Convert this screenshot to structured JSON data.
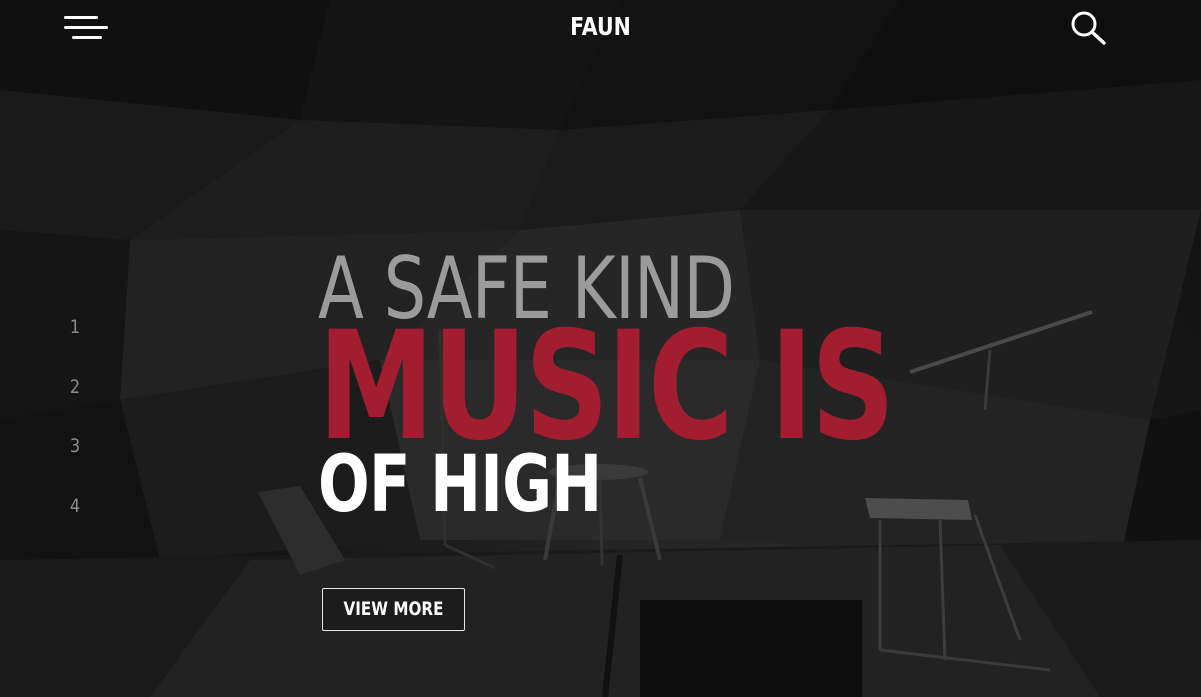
{
  "header": {
    "brand": "FAUN",
    "menu_icon": "hamburger-menu-icon",
    "search_icon": "search-icon"
  },
  "slider_nav": [
    "1",
    "2",
    "3",
    "4"
  ],
  "hero": {
    "line1": "A SAFE KIND",
    "line2": "MUSIC IS",
    "line3": "OF HIGH",
    "cta_label": "VIEW MORE"
  },
  "colors": {
    "accent": "#a21d2f",
    "muted_heading": "#9b9b9b",
    "text": "#ffffff",
    "background": "#0c0c0c"
  }
}
